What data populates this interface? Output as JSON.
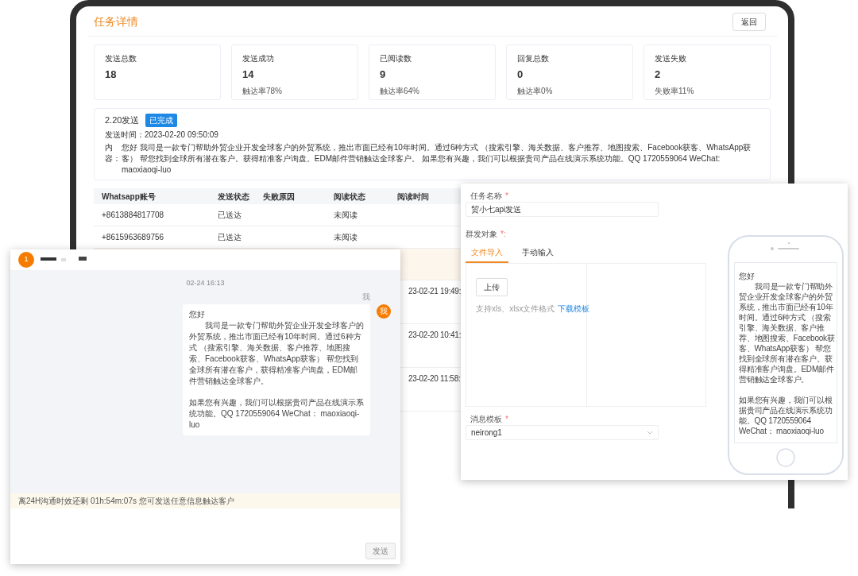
{
  "task_detail": {
    "title": "任务详情",
    "back_button": "返回",
    "stats": [
      {
        "label": "发送总数",
        "value": "18"
      },
      {
        "label": "发送成功",
        "value": "14",
        "note": "触达率78%"
      },
      {
        "label": "已阅读数",
        "value": "9",
        "note": "触达率64%"
      },
      {
        "label": "回复总数",
        "value": "0",
        "note": "触达率0%"
      },
      {
        "label": "发送失败",
        "value": "2",
        "note": "失败率11%"
      }
    ],
    "message": {
      "name": "2.20发送",
      "status": "已完成",
      "send_time": "发送时间：2023-02-20 09:50:09",
      "content_label": "内容：",
      "content": "您好 我司是一款专门帮助外贸企业开发全球客户的外贸系统，推出市面已经有10年时间。通过6种方式 （搜索引擎、海关数据、客户推荐、地图搜索、Facebook获客、WhatsApp获客） 帮您找到全球所有潜在客户。获得精准客户询盘。EDM邮件营销触达全球客户。 如果您有兴趣，我们可以根据贵司产品在线演示系统功能。QQ 1720559064 WeChat:  maoxiaoqi-luo"
    },
    "table": {
      "columns": [
        "Whatsapp账号",
        "发送状态",
        "失败原因",
        "阅读状态",
        "阅读时间"
      ],
      "rows": [
        {
          "account": "+8613884817708",
          "send_status": "已送达",
          "read_status": "未阅读"
        },
        {
          "account": "+8615963689756",
          "send_status": "已送达",
          "read_status": "未阅读"
        }
      ],
      "partial_rows": [
        {
          "read_time": "23-02-21 19:49:"
        },
        {
          "read_time": "23-02-20 10:41:"
        },
        {
          "read_time": "23-02-20 11:58:"
        }
      ]
    }
  },
  "chat": {
    "badge": "1",
    "timestamp": "02-24 16:13",
    "sender": "我",
    "avatar": "我",
    "message": {
      "greeting": "您好",
      "body": "我司是一款专门帮助外贸企业开发全球客户的外贸系统，推出市面已经有10年时间。通过6种方式 （搜索引擎、海关数据、客户推荐、地图搜索、Facebook获客、WhatsApp获客） 帮您找到全球所有潜在客户，获得精准客户询盘，EDM邮件营销触达全球客户。",
      "closing": "如果您有兴趣，我们可以根据贵司产品在线演示系统功能。QQ 1720559064 WeChat： maoxiaoqi-luo"
    },
    "notice": "离24H沟通时效还剩 01h:54m:07s 您可发送任意信息触达客户",
    "send_button": "发送",
    "send_disabled": true
  },
  "task_form": {
    "name_label": {
      "label": "任务名称",
      "mark": "*"
    },
    "name_value": "贸小七api发送",
    "target_label": {
      "label": "群发对象",
      "mark": "*:"
    },
    "tabs": [
      {
        "label": "文件导入",
        "selected": true
      },
      {
        "label": "手动输入",
        "selected": false
      }
    ],
    "upload_button": "上传",
    "hint": "支持xls、xlsx文件格式",
    "template_link": "下载模板",
    "template_label": {
      "label": "消息模板",
      "mark": "*"
    },
    "template_value": "neirong1"
  },
  "phone_preview": {
    "message": {
      "greeting": "您好",
      "body": "我司是一款专门帮助外贸企业开发全球客户的外贸系统，推出市面已经有10年时间。通过6种方式 （搜索引擎、海关数据、客户推荐、地图搜索、Facebook获客、WhatsApp获客） 帮您找到全球所有潜在客户。获得精准客户询盘。EDM邮件营销触达全球客户。",
      "closing": "如果您有兴趣，我们可以根据贵司产品在线演示系统功能。QQ 1720559064 WeChat： maoxiaoqi-luo"
    }
  }
}
